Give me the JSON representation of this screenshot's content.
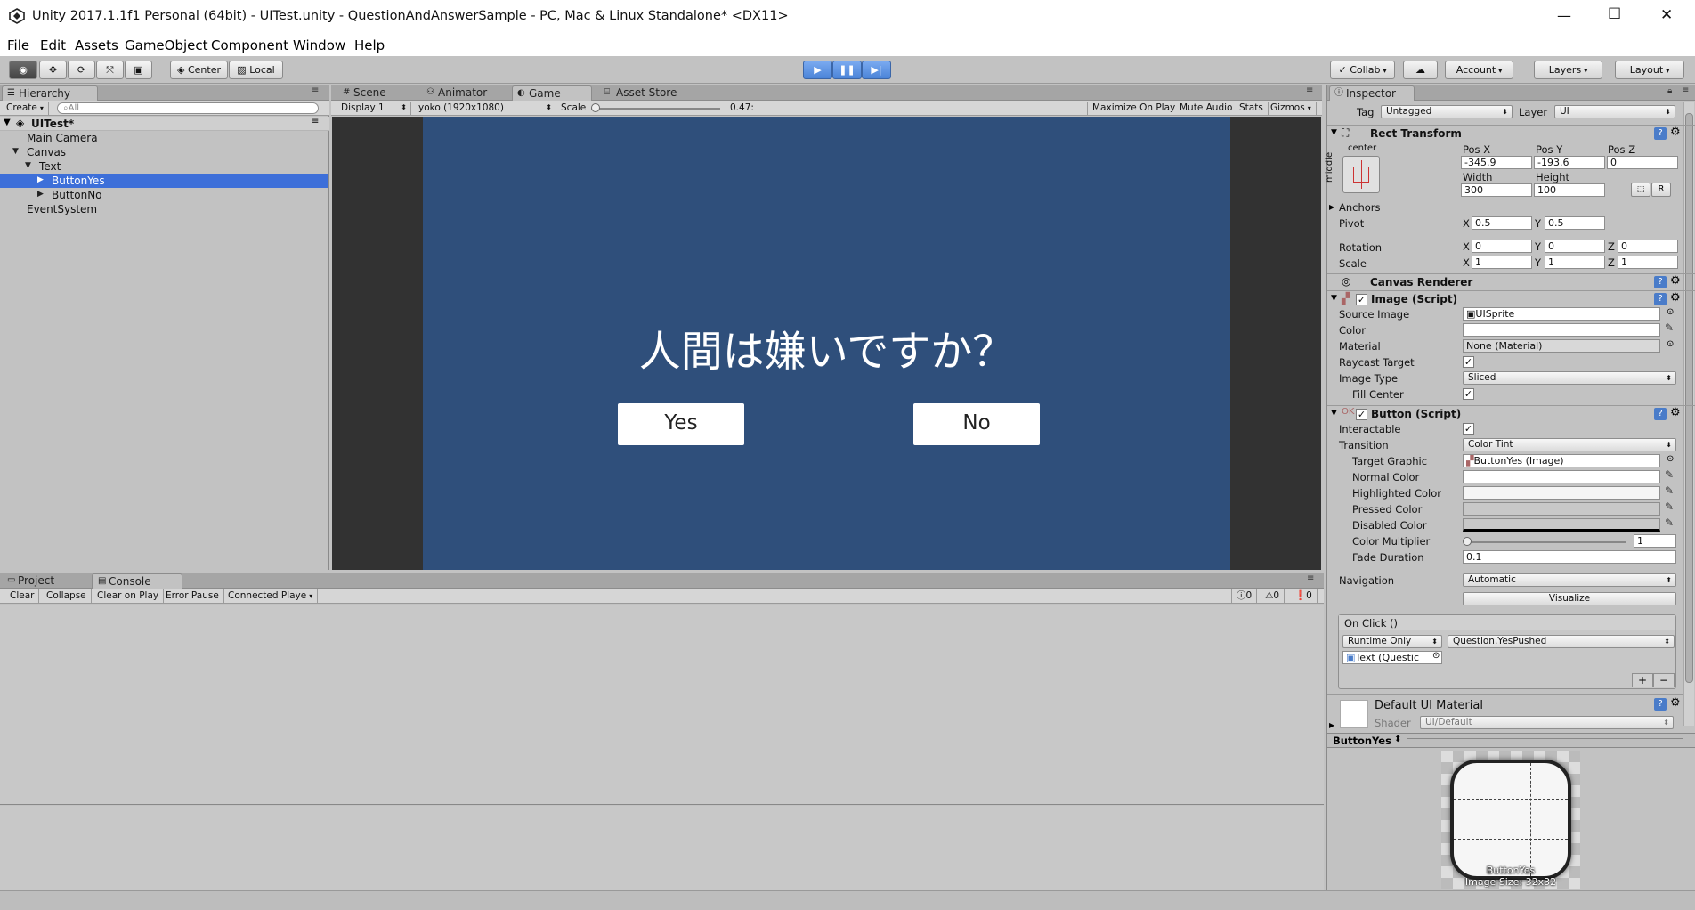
{
  "window": {
    "title": "Unity 2017.1.1f1 Personal (64bit) - UITest.unity - QuestionAndAnswerSample - PC, Mac & Linux Standalone* <DX11>",
    "controls": {
      "minimize": "—",
      "maximize": "☐",
      "close": "✕"
    }
  },
  "menu": [
    "File",
    "Edit",
    "Assets",
    "GameObject",
    "Component",
    "Window",
    "Help"
  ],
  "toolbar": {
    "pivot": "Center",
    "space": "Local",
    "collab": "Collab",
    "account": "Account",
    "layers": "Layers",
    "layout": "Layout"
  },
  "hierarchy": {
    "tab": "Hierarchy",
    "create": "Create",
    "search_placeholder": "All",
    "scene": "UITest*",
    "items": [
      {
        "label": "Main Camera",
        "indent": 1,
        "selected": false
      },
      {
        "label": "Canvas",
        "indent": 1,
        "selected": false
      },
      {
        "label": "Text",
        "indent": 2,
        "selected": false
      },
      {
        "label": "ButtonYes",
        "indent": 3,
        "selected": true
      },
      {
        "label": "ButtonNo",
        "indent": 3,
        "selected": false
      },
      {
        "label": "EventSystem",
        "indent": 1,
        "selected": false
      }
    ]
  },
  "center_tabs": [
    "Scene",
    "Animator",
    "Game",
    "Asset Store"
  ],
  "game_bar": {
    "display": "Display 1",
    "resolution": "yoko (1920x1080)",
    "scale_label": "Scale",
    "scale_value": "0.47:",
    "maximize": "Maximize On Play",
    "mute": "Mute Audio",
    "stats": "Stats",
    "gizmos": "Gizmos"
  },
  "game": {
    "question": "人間は嫌いですか？",
    "yes": "Yes",
    "no": "No",
    "bg_color": "#2f4f7b"
  },
  "bottom_tabs": [
    "Project",
    "Console"
  ],
  "console": {
    "buttons": [
      "Clear",
      "Collapse",
      "Clear on Play",
      "Error Pause",
      "Connected Playe"
    ],
    "counts": [
      "0",
      "0",
      "0"
    ]
  },
  "inspector": {
    "tab": "Inspector",
    "tag_label": "Tag",
    "tag_value": "Untagged",
    "layer_label": "Layer",
    "layer_value": "UI",
    "rect_transform": {
      "title": "Rect Transform",
      "anchor_h": "center",
      "anchor_v": "middle",
      "pos_x_label": "Pos X",
      "pos_x": "-345.9",
      "pos_y_label": "Pos Y",
      "pos_y": "-193.6",
      "pos_z_label": "Pos Z",
      "pos_z": "0",
      "width_label": "Width",
      "width": "300",
      "height_label": "Height",
      "height": "100",
      "anchors": "Anchors",
      "pivot_label": "Pivot",
      "pivot_x": "0.5",
      "pivot_y": "0.5",
      "rotation_label": "Rotation",
      "rot_x": "0",
      "rot_y": "0",
      "rot_z": "0",
      "scale_label": "Scale",
      "scale_x": "1",
      "scale_y": "1",
      "scale_z": "1",
      "x": "X",
      "y": "Y",
      "z": "Z",
      "r_button": "R"
    },
    "canvas_renderer": "Canvas Renderer",
    "image": {
      "title": "Image (Script)",
      "source_image_label": "Source Image",
      "source_image": "UISprite",
      "color_label": "Color",
      "material_label": "Material",
      "material": "None (Material)",
      "raycast_label": "Raycast Target",
      "image_type_label": "Image Type",
      "image_type": "Sliced",
      "fill_center_label": "Fill Center"
    },
    "button": {
      "title": "Button (Script)",
      "interactable_label": "Interactable",
      "transition_label": "Transition",
      "transition": "Color Tint",
      "target_graphic_label": "Target Graphic",
      "target_graphic": "ButtonYes (Image)",
      "normal_label": "Normal Color",
      "highlighted_label": "Highlighted Color",
      "pressed_label": "Pressed Color",
      "disabled_label": "Disabled Color",
      "multiplier_label": "Color Multiplier",
      "multiplier": "1",
      "fade_label": "Fade Duration",
      "fade": "0.1",
      "navigation_label": "Navigation",
      "navigation": "Automatic",
      "visualize": "Visualize",
      "onclick": "On Click ()",
      "runtime": "Runtime Only",
      "function": "Question.YesPushed",
      "object": "Text (Questic",
      "plus": "+",
      "minus": "−"
    },
    "material_section": {
      "name": "Default UI Material",
      "shader_label": "Shader",
      "shader": "UI/Default"
    },
    "preview": {
      "title": "ButtonYes",
      "name": "ButtonYes",
      "size": "Image Size: 32x32"
    }
  }
}
